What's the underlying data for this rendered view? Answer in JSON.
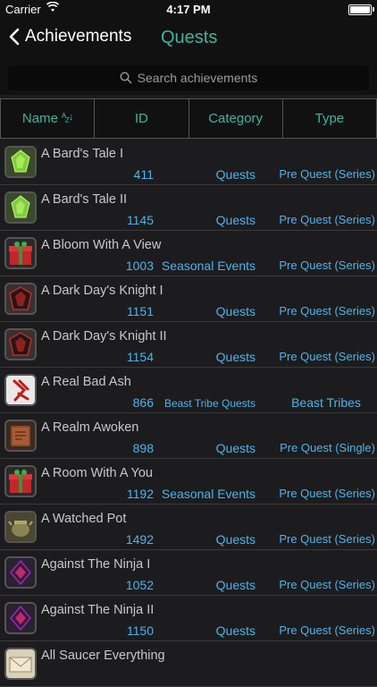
{
  "status": {
    "carrier": "Carrier",
    "time": "4:17 PM"
  },
  "nav": {
    "back_label": "Achievements",
    "title": "Quests"
  },
  "search": {
    "placeholder": "Search achievements"
  },
  "columns": [
    "Name",
    "ID",
    "Category",
    "Type"
  ],
  "rows": [
    {
      "name": "A Bard's Tale I",
      "id": "411",
      "category": "Quests",
      "type": "Pre Quest (Series)",
      "icon": "green-crystal-icon"
    },
    {
      "name": "A Bard's Tale II",
      "id": "1145",
      "category": "Quests",
      "type": "Pre Quest (Series)",
      "icon": "green-crystal-icon"
    },
    {
      "name": "A Bloom With A View",
      "id": "1003",
      "category": "Seasonal Events",
      "type": "Pre Quest (Series)",
      "icon": "gift-box-icon"
    },
    {
      "name": "A Dark Day's Knight I",
      "id": "1151",
      "category": "Quests",
      "type": "Pre Quest (Series)",
      "icon": "dark-crest-icon"
    },
    {
      "name": "A Dark Day's Knight II",
      "id": "1154",
      "category": "Quests",
      "type": "Pre Quest (Series)",
      "icon": "dark-crest-icon"
    },
    {
      "name": "A Real Bad Ash",
      "id": "866",
      "category": "Beast Tribe Quests",
      "type": "Beast Tribes",
      "icon": "red-rune-icon"
    },
    {
      "name": "A Realm Awoken",
      "id": "898",
      "category": "Quests",
      "type": "Pre Quest (Single)",
      "icon": "book-icon"
    },
    {
      "name": "A Room With A You",
      "id": "1192",
      "category": "Seasonal Events",
      "type": "Pre Quest (Series)",
      "icon": "gift-box-icon"
    },
    {
      "name": "A Watched Pot",
      "id": "1492",
      "category": "Quests",
      "type": "Pre Quest (Series)",
      "icon": "pot-icon"
    },
    {
      "name": "Against The Ninja I",
      "id": "1052",
      "category": "Quests",
      "type": "Pre Quest (Series)",
      "icon": "ninja-crystal-icon"
    },
    {
      "name": "Against The Ninja II",
      "id": "1150",
      "category": "Quests",
      "type": "Pre Quest (Series)",
      "icon": "ninja-crystal-icon"
    },
    {
      "name": "All Saucer Everything",
      "id": "",
      "category": "",
      "type": "",
      "icon": "envelope-icon"
    }
  ]
}
